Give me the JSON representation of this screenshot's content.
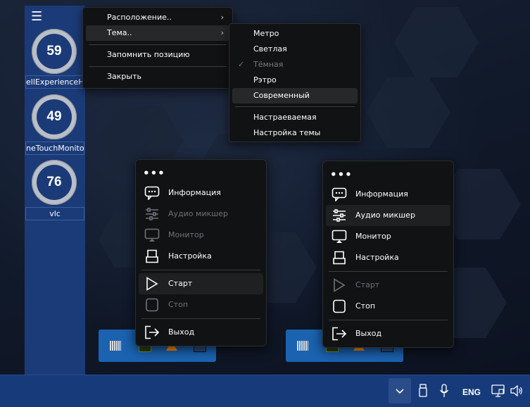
{
  "desktop": {
    "left_widgets": [
      {
        "value": "59",
        "label": "ellExperienceH"
      },
      {
        "value": "49",
        "label": "neTouchMonito"
      },
      {
        "value": "76",
        "label": "vlc"
      }
    ]
  },
  "context_menu": {
    "items": [
      {
        "label": "Расположение..",
        "submenu": true
      },
      {
        "label": "Тема..",
        "submenu": true
      },
      {
        "label": "Запомнить позицию"
      },
      {
        "label": "Закрыть"
      }
    ]
  },
  "theme_submenu": {
    "items": [
      {
        "label": "Метро"
      },
      {
        "label": "Светлая"
      },
      {
        "label": "Тёмная",
        "checked": true,
        "check_glyph": "✓"
      },
      {
        "label": "Рэтро"
      },
      {
        "label": "Современный"
      },
      {
        "label": "Настраеваемая"
      },
      {
        "label": "Настройка темы"
      }
    ]
  },
  "popup_left": {
    "dots": "•••",
    "items": [
      {
        "label": "Информация",
        "icon": "chat-bubble-icon",
        "enabled": true
      },
      {
        "label": "Аудио микшер",
        "icon": "mixer-sliders-icon",
        "enabled": false
      },
      {
        "label": "Монитор",
        "icon": "monitor-icon",
        "enabled": false
      },
      {
        "label": "Настройка",
        "icon": "settings-chair-icon",
        "enabled": true
      },
      {
        "label": "Старт",
        "icon": "play-icon",
        "enabled": true
      },
      {
        "label": "Стоп",
        "icon": "stop-icon",
        "enabled": false
      },
      {
        "label": "Выход",
        "icon": "exit-icon",
        "enabled": true
      }
    ]
  },
  "popup_right": {
    "dots": "•••",
    "items": [
      {
        "label": "Информация",
        "icon": "chat-bubble-icon",
        "enabled": true
      },
      {
        "label": "Аудио микшер",
        "icon": "mixer-sliders-icon",
        "enabled": true
      },
      {
        "label": "Монитор",
        "icon": "monitor-icon",
        "enabled": true
      },
      {
        "label": "Настройка",
        "icon": "settings-chair-icon",
        "enabled": true
      },
      {
        "label": "Старт",
        "icon": "play-icon",
        "enabled": false
      },
      {
        "label": "Стоп",
        "icon": "stop-icon",
        "enabled": true
      },
      {
        "label": "Выход",
        "icon": "exit-icon",
        "enabled": true
      }
    ]
  },
  "taskbar": {
    "language": "ENG",
    "tray_icons": [
      "chevron-up-icon",
      "usb-drive-icon",
      "microphone-icon",
      "display-network-icon",
      "speaker-icon"
    ]
  },
  "colors": {
    "accent": "#1b3b78",
    "taskbar": "#173b7a",
    "menu_bg": "#111214",
    "strip": "#1b62b0"
  }
}
